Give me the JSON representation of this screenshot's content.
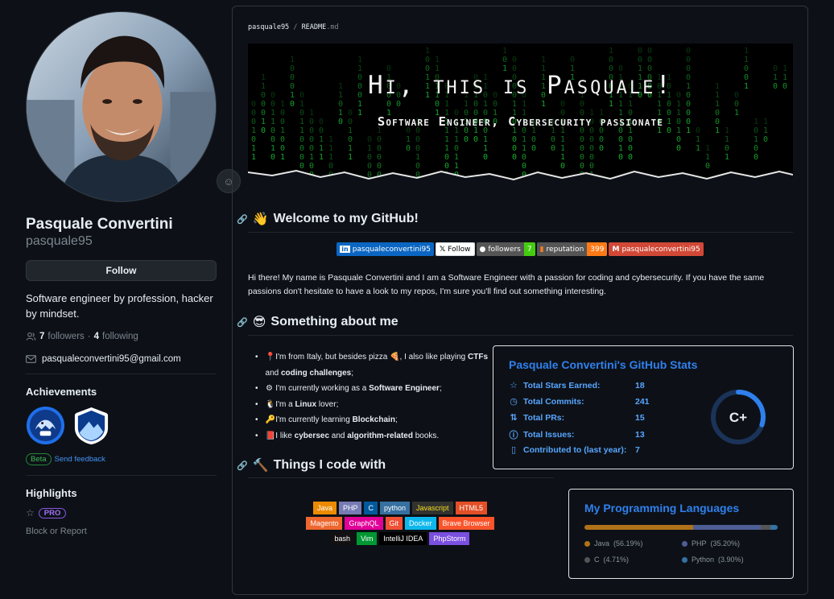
{
  "profile": {
    "name": "Pasquale Convertini",
    "login": "pasquale95",
    "follow_label": "Follow",
    "bio": "Software engineer by profession, hacker by mindset.",
    "followers_count": "7",
    "followers_label": "followers",
    "dot": "·",
    "following_count": "4",
    "following_label": "following",
    "email": "pasqualeconvertini95@gmail.com"
  },
  "achievements": {
    "title": "Achievements",
    "beta_label": "Beta",
    "feedback_label": "Send feedback"
  },
  "highlights": {
    "title": "Highlights",
    "pro_label": "PRO",
    "block_label": "Block or Report"
  },
  "readme": {
    "breadcrumb_user": "pasquale95",
    "breadcrumb_sep": "/",
    "breadcrumb_file": "README",
    "breadcrumb_ext": ".md",
    "banner_title": "Hi, this is Pasquale!",
    "banner_subtitle": "Software Engineer, Cybersecurity passionate",
    "welcome_heading": "Welcome to my GitHub!",
    "welcome_emoji": "👋",
    "intro": "Hi there! My name is Pasquale Convertini and I am a Software Engineer with a passion for coding and cybersecurity. If you have the same passions don't hesitate to have a look to my repos, I'm sure you'll find out something interesting.",
    "about_heading": "Something about me",
    "about_emoji": "😎",
    "code_heading": "Things I code with",
    "code_emoji": "🔨",
    "link_icon": "🔗"
  },
  "shields": {
    "linkedin": "pasqualeconvertini95",
    "x_follow": "Follow",
    "followers_label": "followers",
    "followers_value": "7",
    "reputation_label": "reputation",
    "reputation_value": "399",
    "gmail": "pasqualeconvertini95"
  },
  "about_items": [
    {
      "emoji": "📍",
      "pre": "I'm from Italy, but besides pizza ",
      "emoji2": "🍕",
      "mid": ", I also like playing ",
      "b1": "CTFs",
      "and": " and ",
      "b2": "coding challenges",
      "post": ";"
    },
    {
      "emoji": "⚙",
      "pre": "I'm currently working as a ",
      "b1": "Software Engineer",
      "post": ";"
    },
    {
      "emoji": "🐧",
      "pre": "I'm a ",
      "b1": "Linux",
      "post": " lover;"
    },
    {
      "emoji": "🔑",
      "pre": "I'm currently learning ",
      "b1": "Blockchain",
      "post": ";"
    },
    {
      "emoji": "📕",
      "pre": "I like ",
      "b1": "cybersec",
      "and": " and ",
      "b2": "algorithm-related",
      "post": " books."
    }
  ],
  "stats": {
    "title": "Pasquale Convertini's GitHub Stats",
    "rows": [
      {
        "label": "Total Stars Earned:",
        "value": "18",
        "icon": "star-icon"
      },
      {
        "label": "Total Commits:",
        "value": "241",
        "icon": "history-icon"
      },
      {
        "label": "Total PRs:",
        "value": "15",
        "icon": "pull-request-icon"
      },
      {
        "label": "Total Issues:",
        "value": "13",
        "icon": "issue-icon"
      },
      {
        "label": "Contributed to (last year):",
        "value": "7",
        "icon": "repo-icon"
      }
    ],
    "grade": "C+",
    "grade_progress": 0.3,
    "accent": "#2f80ed"
  },
  "tools": [
    [
      {
        "label": "Java",
        "color": "#ED8B00"
      },
      {
        "label": "PHP",
        "color": "#777BB4"
      },
      {
        "label": "C",
        "color": "#00599C"
      },
      {
        "label": "python",
        "color": "#3670A0"
      },
      {
        "label": "Javascript",
        "color": "#323330",
        "text": "#F7DF1E"
      },
      {
        "label": "HTML5",
        "color": "#E34F26"
      }
    ],
    [
      {
        "label": "Magento",
        "color": "#EE672F"
      },
      {
        "label": "GraphQL",
        "color": "#E10098"
      },
      {
        "label": "Git",
        "color": "#F05033"
      },
      {
        "label": "Docker",
        "color": "#0db7ed"
      },
      {
        "label": "Brave Browser",
        "color": "#FB542B"
      }
    ],
    [
      {
        "label": "bash",
        "color": "#121011"
      },
      {
        "label": "Vim",
        "color": "#019733"
      },
      {
        "label": "IntelliJ IDEA",
        "color": "#000000"
      },
      {
        "label": "PhpStorm",
        "color": "#7B4FE0"
      }
    ]
  ],
  "languages": {
    "title": "My Programming Languages",
    "items": [
      {
        "name": "Java",
        "pct": "56.19%",
        "value": 56.19,
        "color": "#b07219"
      },
      {
        "name": "PHP",
        "pct": "35.20%",
        "value": 35.2,
        "color": "#4F5D95"
      },
      {
        "name": "C",
        "pct": "4.71%",
        "value": 4.71,
        "color": "#555555"
      },
      {
        "name": "Python",
        "pct": "3.90%",
        "value": 3.9,
        "color": "#3572A5"
      }
    ]
  }
}
